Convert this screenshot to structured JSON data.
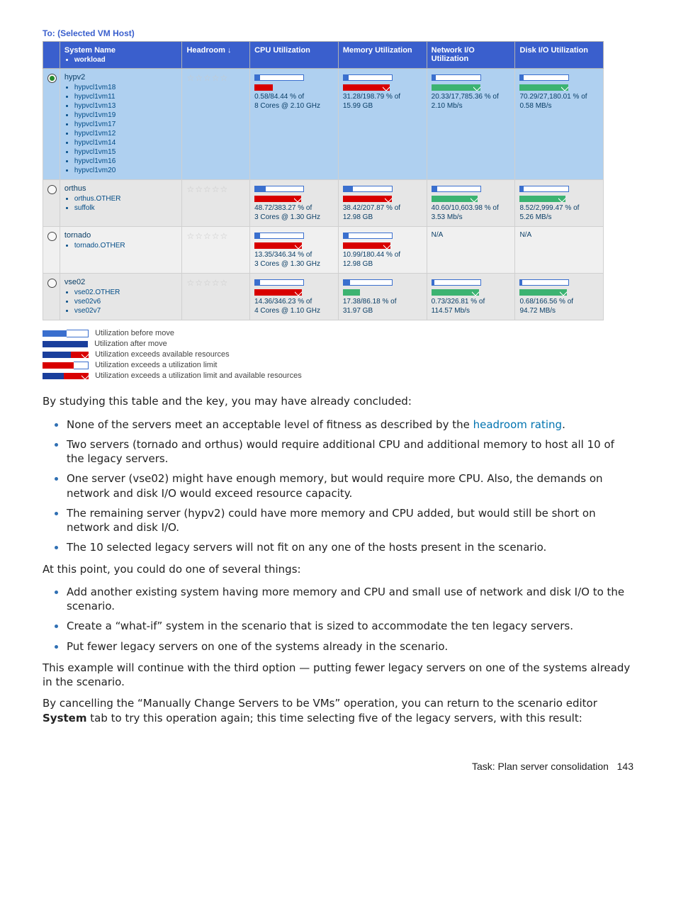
{
  "title": "To: (Selected VM Host)",
  "columns": {
    "c1": "System Name",
    "c1sub": "workload",
    "c2": "Headroom ↓",
    "c3": "CPU Utilization",
    "c4": "Memory Utilization",
    "c5": "Network I/O Utilization",
    "c6": "Disk I/O Utilization"
  },
  "rows": [
    {
      "sel": true,
      "name": "hypv2",
      "items": [
        "hypvcl1vm18",
        "hypvcl1vm11",
        "hypvcl1vm13",
        "hypvcl1vm19",
        "hypvcl1vm17",
        "hypvcl1vm12",
        "hypvcl1vm14",
        "hypvcl1vm15",
        "hypvcl1vm16",
        "hypvcl1vm20"
      ],
      "stars": "☆☆☆☆☆",
      "cpu": {
        "before": [
          8,
          "blue"
        ],
        "after": [
          [
            26,
            "red"
          ]
        ],
        "txt1": "0.58/84.44 % of",
        "txt2": "8 Cores @ 2.10 GHz"
      },
      "mem": {
        "before": [
          8,
          "blue"
        ],
        "after": [
          [
            22,
            "red"
          ],
          [
            35,
            "red",
            "flag"
          ]
        ],
        "txt1": "31.28/198.79 % of",
        "txt2": "15.99  GB"
      },
      "net": {
        "before": [
          6,
          "blue"
        ],
        "after": [
          [
            12,
            "green"
          ],
          [
            48,
            "green",
            "flag"
          ]
        ],
        "txt1": "20.33/17,785.36 % of",
        "txt2": "2.10 Mb/s"
      },
      "disk": {
        "before": [
          6,
          "blue"
        ],
        "after": [
          [
            12,
            "green"
          ],
          [
            48,
            "green",
            "flag"
          ]
        ],
        "txt1": "70.29/27,180.01 % of",
        "txt2": "0.58 MB/s"
      }
    },
    {
      "sel": false,
      "name": "orthus",
      "items": [
        "orthus.OTHER",
        "suffolk"
      ],
      "stars": "☆☆☆☆☆",
      "cpu": {
        "before": [
          16,
          "blue"
        ],
        "after": [
          [
            22,
            "red"
          ],
          [
            35,
            "red",
            "flag"
          ]
        ],
        "txt1": "48.72/383.27 % of",
        "txt2": "3 Cores @ 1.30 GHz"
      },
      "mem": {
        "before": [
          14,
          "blue"
        ],
        "after": [
          [
            20,
            "red"
          ],
          [
            40,
            "red",
            "flag"
          ]
        ],
        "txt1": "38.42/207.87 % of",
        "txt2": "12.98  GB"
      },
      "net": {
        "before": [
          8,
          "blue"
        ],
        "after": [
          [
            14,
            "green"
          ],
          [
            42,
            "green",
            "flag"
          ]
        ],
        "txt1": "40.60/10,603.98 % of",
        "txt2": "3.53 Mb/s"
      },
      "disk": {
        "before": [
          6,
          "blue"
        ],
        "after": [
          [
            10,
            "green"
          ],
          [
            46,
            "green",
            "flag"
          ]
        ],
        "txt1": "8.52/2,999.47 % of",
        "txt2": "5.26 MB/s"
      }
    },
    {
      "sel": false,
      "name": "tornado",
      "items": [
        "tornado.OTHER"
      ],
      "stars": "☆☆☆☆☆",
      "cpu": {
        "before": [
          8,
          "blue"
        ],
        "after": [
          [
            18,
            "red"
          ],
          [
            40,
            "red",
            "flag"
          ]
        ],
        "txt1": "13.35/346.34 % of",
        "txt2": "3 Cores @ 1.30 GHz"
      },
      "mem": {
        "before": [
          8,
          "blue"
        ],
        "after": [
          [
            18,
            "red"
          ],
          [
            40,
            "red",
            "flag"
          ]
        ],
        "txt1": "10.99/180.44 % of",
        "txt2": "12.98  GB"
      },
      "net": {
        "na": true
      },
      "disk": {
        "na": true
      }
    },
    {
      "sel": false,
      "name": "vse02",
      "items": [
        "vse02.OTHER",
        "vse02v6",
        "vse02v7"
      ],
      "stars": "☆☆☆☆☆",
      "cpu": {
        "before": [
          8,
          "blue"
        ],
        "after": [
          [
            16,
            "red"
          ],
          [
            42,
            "red",
            "flag"
          ]
        ],
        "txt1": "14.36/346.23 % of",
        "txt2": "4 Cores @ 1.10 GHz"
      },
      "mem": {
        "before": [
          10,
          "blue"
        ],
        "after": [
          [
            24,
            "green"
          ]
        ],
        "txt1": "17.38/86.18 % of",
        "txt2": "31.97  GB"
      },
      "net": {
        "before": [
          4,
          "blue"
        ],
        "after": [
          [
            10,
            "green"
          ],
          [
            48,
            "green",
            "flag"
          ]
        ],
        "txt1": "0.73/326.81 % of",
        "txt2": "114.57 Mb/s"
      },
      "disk": {
        "before": [
          4,
          "blue"
        ],
        "after": [
          [
            10,
            "green"
          ],
          [
            48,
            "green",
            "flag"
          ]
        ],
        "txt1": "0.68/166.56 % of",
        "txt2": "94.72 MB/s"
      }
    }
  ],
  "na_label": "N/A",
  "legend": [
    "Utilization before move",
    "Utilization after move",
    "Utilization exceeds available resources",
    "Utilization exceeds a utilization limit",
    "Utilization exceeds a utilization limit and available resources"
  ],
  "prose": {
    "intro": "By studying this table and the key, you may have already concluded:",
    "bullets1": [
      [
        "None of the servers meet an acceptable level of fitness as described by the ",
        "headroom rating",
        "."
      ],
      [
        "Two servers (tornado and orthus) would require additional CPU and additional memory to host all 10 of the legacy servers."
      ],
      [
        "One server (vse02) might have enough memory, but would require more CPU. Also, the demands on network and disk I/O would exceed resource capacity."
      ],
      [
        "The remaining server (hypv2) could have more memory and CPU added, but would still be short on network and disk I/O."
      ],
      [
        "The 10 selected legacy servers will not fit on any one of the hosts present in the scenario."
      ]
    ],
    "mid": "At this point, you could do one of several things:",
    "bullets2": [
      "Add another existing system having more memory and CPU and small use of network and disk I/O to the scenario.",
      "Create a “what-if” system in the scenario that is sized to accommodate the ten legacy servers.",
      "Put fewer legacy servers on one of the systems already in the scenario."
    ],
    "after1": "This example will continue with the third option — putting fewer legacy servers on one of the systems already in the scenario.",
    "after2a": "By cancelling the “Manually Change Servers to be VMs” operation, you can return to the scenario editor ",
    "after2b": "System",
    "after2c": " tab to try this operation again; this time selecting five of the legacy servers, with this result:"
  },
  "footer": {
    "label": "Task: Plan server consolidation",
    "page": "143"
  }
}
